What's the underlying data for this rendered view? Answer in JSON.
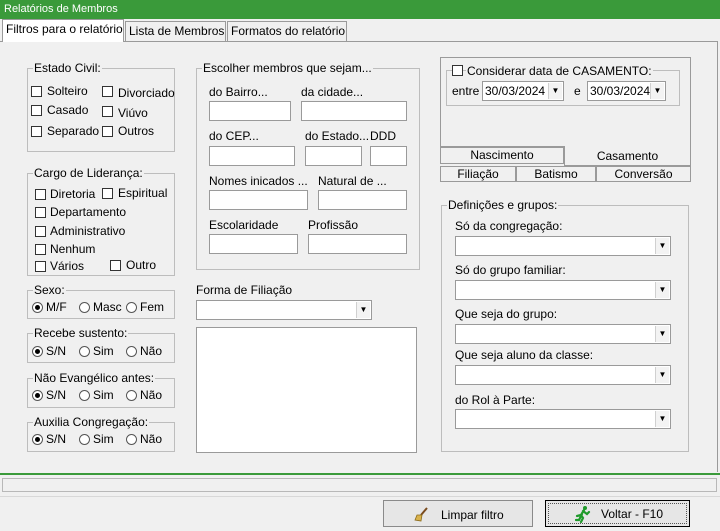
{
  "window": {
    "title": "Relatórios de Membros"
  },
  "tabs": [
    {
      "label": "Filtros para o relatório",
      "active": true
    },
    {
      "label": "Lista de Membros",
      "active": false
    },
    {
      "label": "Formatos do relatório",
      "active": false
    }
  ],
  "estado_civil": {
    "title": "Estado Civil:",
    "options": [
      {
        "label": "Solteiro",
        "checked": false
      },
      {
        "label": "Divorciado",
        "checked": false
      },
      {
        "label": "Casado",
        "checked": false
      },
      {
        "label": "Viúvo",
        "checked": false
      },
      {
        "label": "Separado",
        "checked": false
      },
      {
        "label": "Outros",
        "checked": false
      }
    ]
  },
  "cargo": {
    "title": "Cargo de Liderança:",
    "options": [
      {
        "label": "Diretoria",
        "checked": false
      },
      {
        "label": "Espiritual",
        "checked": false
      },
      {
        "label": "Departamento",
        "checked": false
      },
      {
        "label": "Administrativo",
        "checked": false
      },
      {
        "label": "Nenhum",
        "checked": false
      },
      {
        "label": "Vários",
        "checked": false
      },
      {
        "label": "Outro",
        "checked": false
      }
    ]
  },
  "sexo": {
    "title": "Sexo:",
    "options": [
      "M/F",
      "Masc",
      "Fem"
    ],
    "selected": "M/F"
  },
  "recebe_sustento": {
    "title": "Recebe sustento:",
    "options": [
      "S/N",
      "Sim",
      "Não"
    ],
    "selected": "S/N"
  },
  "nao_evangelico": {
    "title": "Não Evangélico antes:",
    "options": [
      "S/N",
      "Sim",
      "Não"
    ],
    "selected": "S/N"
  },
  "auxilia": {
    "title": "Auxilia Congregação:",
    "options": [
      "S/N",
      "Sim",
      "Não"
    ],
    "selected": "S/N"
  },
  "membros": {
    "title": "Escolher membros que sejam...",
    "bairro": {
      "label": "do Bairro...",
      "value": ""
    },
    "cidade": {
      "label": "da cidade...",
      "value": ""
    },
    "cep": {
      "label": "do CEP...",
      "value": ""
    },
    "estado": {
      "label": "do Estado...",
      "value": ""
    },
    "ddd": {
      "label": "DDD",
      "value": ""
    },
    "nomes": {
      "label": "Nomes inicados ...",
      "value": ""
    },
    "natural": {
      "label": "Natural de ...",
      "value": ""
    },
    "escolaridade": {
      "label": "Escolaridade",
      "value": ""
    },
    "profissao": {
      "label": "Profissão",
      "value": ""
    }
  },
  "filiacao": {
    "label": "Forma de Filiação",
    "value": ""
  },
  "casamento": {
    "checkbox_label": "Considerar data de CASAMENTO:",
    "checked": false,
    "entre": "entre",
    "e": "e",
    "date_from": "30/03/2024",
    "date_to": "30/03/2024"
  },
  "date_tabs": [
    "Nascimento",
    "Casamento",
    "Filiação",
    "Batismo",
    "Conversão"
  ],
  "definicoes": {
    "title": "Definições e grupos:",
    "fields": [
      {
        "label": "Só da congregação:",
        "value": ""
      },
      {
        "label": "Só do grupo familiar:",
        "value": ""
      },
      {
        "label": "Que seja do grupo:",
        "value": ""
      },
      {
        "label": "Que seja aluno da classe:",
        "value": ""
      },
      {
        "label": "do Rol à Parte:",
        "value": ""
      }
    ]
  },
  "buttons": {
    "limpar": "Limpar filtro",
    "voltar": "Voltar - F10"
  },
  "colors": {
    "titlebar": "#3a9a3a",
    "statusbar": "#3a9a3a",
    "icon_green": "#1f9a2a"
  },
  "icons": {
    "limpar": "broom-icon",
    "voltar": "running-man-icon"
  }
}
